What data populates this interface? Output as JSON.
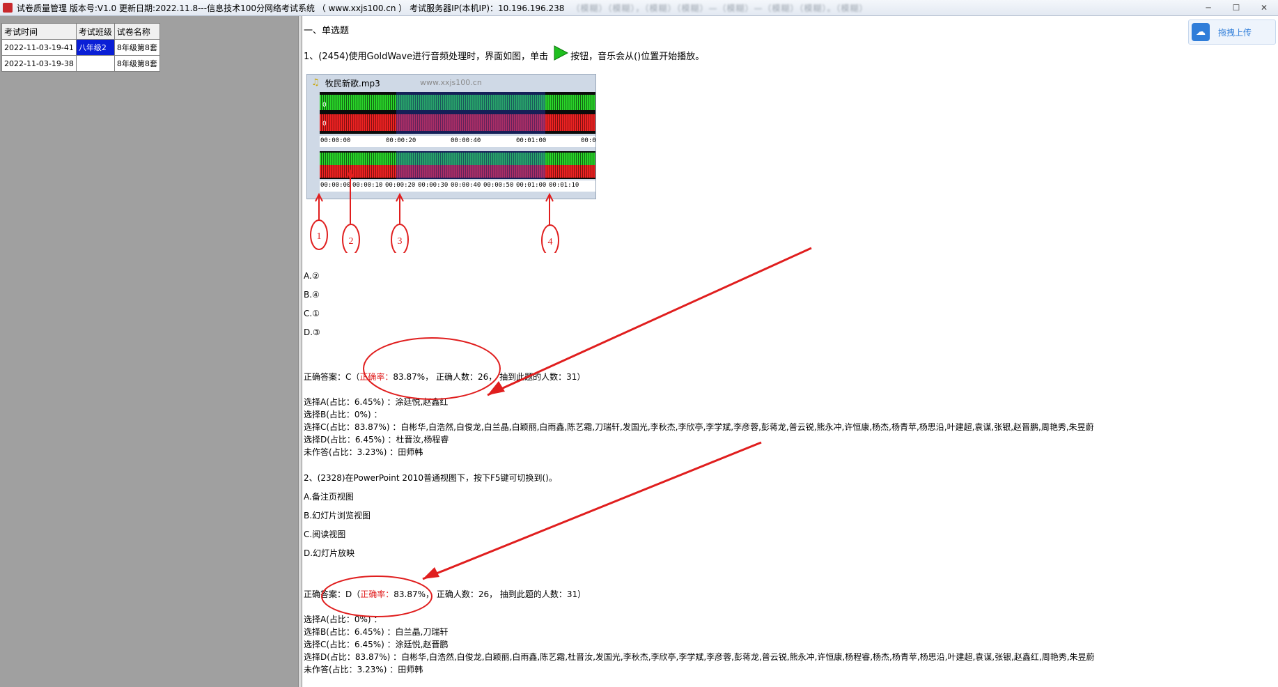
{
  "window": {
    "title": "试卷质量管理 版本号:V1.0 更新日期:2022.11.8---信息技术100分网络考试系统 （ www.xxjs100.cn ）   考试服务器IP(本机IP)：10.196.196.238",
    "title_blur": "（模糊）（模糊），（模糊）（模糊）—（模糊）—（模糊）（模糊）。（模糊）"
  },
  "left_table": {
    "headers": [
      "考试时间",
      "考试班级",
      "试卷名称"
    ],
    "rows": [
      {
        "time": "2022-11-03-19-41",
        "class": "八年级2",
        "paper": "8年级第8套"
      },
      {
        "time": "2022-11-03-19-38",
        "class": "",
        "paper": "8年级第8套"
      }
    ]
  },
  "upload": {
    "label": "拖拽上传"
  },
  "section_title": "一、单选题",
  "q1": {
    "stem_before": "1、(2454)使用GoldWave进行音频处理时，界面如图，单击",
    "stem_after": "按钮，音乐会从()位置开始播放。",
    "screenshot": {
      "filename": "牧民新歌.mp3",
      "watermark": "www.xxjs100.cn",
      "ruler_top": [
        "00:00:00",
        "00:00:20",
        "00:00:40",
        "00:01:00",
        "00:0"
      ],
      "ruler_bottom": [
        "00:00:00",
        "00:00:10",
        "00:00:20",
        "00:00:30",
        "00:00:40",
        "00:00:50",
        "00:01:00",
        "00:01:10"
      ],
      "zero_labels": [
        "0",
        "0"
      ],
      "callouts": [
        "1",
        "2",
        "3",
        "4"
      ]
    },
    "options": [
      "A.②",
      "B.④",
      "C.①",
      "D.③"
    ],
    "answer_prefix": "正确答案：C（",
    "rate_label": "正确率：",
    "rate_value": "83.87%",
    "answer_suffix": "， 正确人数：26， 抽到此题的人数：31）",
    "stats": [
      "选择A(占比：6.45%)  ：涂廷悦,赵鑫红",
      "选择B(占比：0%)  ：",
      "选择C(占比：83.87%)  ：白彬华,白浩然,白俊龙,白兰晶,白颖丽,白雨鑫,陈艺霜,刀瑞轩,发国光,李秋杰,李欣亭,李学斌,李彦蓉,彭蒋龙,普云锐,熊永冲,许恒康,杨杰,杨青苹,杨思沿,叶建超,袁谋,张银,赵晋鹏,周艳秀,朱昱蔚",
      "选择D(占比：6.45%)  ：杜晋汝,杨程睿",
      "未作答(占比：3.23%)  ：田师韩"
    ]
  },
  "q2": {
    "stem": "2、(2328)在PowerPoint 2010普通视图下，按下F5键可切换到()。",
    "options": [
      "A.备注页视图",
      "B.幻灯片浏览视图",
      "C.阅读视图",
      "D.幻灯片放映"
    ],
    "answer_prefix": "正确答案：D（",
    "rate_label": "正确率：",
    "rate_value": "83.87%",
    "answer_suffix": "， 正确人数：26， 抽到此题的人数：31）",
    "stats": [
      "选择A(占比：0%)  ：",
      "选择B(占比：6.45%)  ：白兰晶,刀瑞轩",
      "选择C(占比：6.45%)  ：涂廷悦,赵晋鹏",
      "选择D(占比：83.87%)  ：白彬华,白浩然,白俊龙,白颖丽,白雨鑫,陈艺霜,杜晋汝,发国光,李秋杰,李欣亭,李学斌,李彦蓉,彭蒋龙,普云锐,熊永冲,许恒康,杨程睿,杨杰,杨青苹,杨思沿,叶建超,袁谋,张银,赵鑫红,周艳秀,朱昱蔚",
      "未作答(占比：3.23%)  ：田师韩"
    ]
  },
  "colors": {
    "accent_red": "#e01e1e",
    "selected_cell": "#0a1fd6",
    "upload_blue": "#2f7dd9"
  }
}
